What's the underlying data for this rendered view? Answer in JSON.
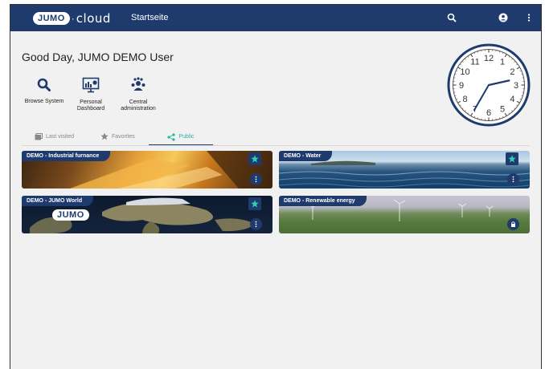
{
  "topbar": {
    "logo_brand": "JUMO",
    "logo_dot": "·",
    "logo_product": "cloud",
    "title": "Startseite",
    "icons": [
      "search-icon",
      "account-icon",
      "more-vert-icon"
    ]
  },
  "greeting": "Good Day,  JUMO  DEMO User",
  "shortcuts": [
    {
      "label": "Browse System",
      "icon": "search-icon"
    },
    {
      "label": "Personal Dashboard",
      "icon": "dashboard-icon"
    },
    {
      "label": "Central administration",
      "icon": "group-icon"
    }
  ],
  "tabs": [
    {
      "label": "Last visited",
      "icon": "history-icon"
    },
    {
      "label": "Favorites",
      "icon": "star-icon"
    },
    {
      "label": "Public",
      "icon": "share-icon",
      "active": true
    }
  ],
  "cards": [
    {
      "title": "DEMO - Industrial furnance",
      "favorite": true,
      "menu": true
    },
    {
      "title": "DEMO - Water",
      "favorite": true,
      "menu": true
    },
    {
      "title": "DEMO - JUMO World",
      "overlay_logo": "JUMO",
      "favorite": true,
      "menu": true
    },
    {
      "title": "DEMO - Renewable energy",
      "locked": true
    }
  ],
  "clock": {
    "numerals": [
      "12",
      "1",
      "2",
      "3",
      "4",
      "5",
      "6",
      "7",
      "8",
      "9",
      "10",
      "11"
    ],
    "hour": 2,
    "minute": 35
  },
  "colors": {
    "primary": "#1f3b6e",
    "accent": "#2bb3a0",
    "background": "#f1f1f1"
  }
}
